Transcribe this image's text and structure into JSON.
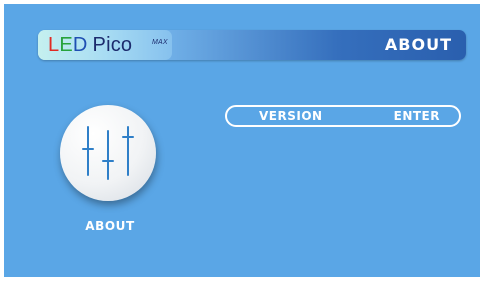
{
  "header": {
    "logo": {
      "led_l": "L",
      "led_e": "E",
      "led_d": "D",
      "pico": "Pico",
      "max": "MAX"
    },
    "title": "ABOUT"
  },
  "main_icon": {
    "icon": "sliders-icon",
    "label": "ABOUT"
  },
  "menu": {
    "items": [
      {
        "label": "VERSION",
        "action": "ENTER"
      }
    ]
  },
  "colors": {
    "background": "#5aa6e6",
    "header_dark": "#2a5fae",
    "text": "#ffffff",
    "slider": "#2f7fc8"
  }
}
